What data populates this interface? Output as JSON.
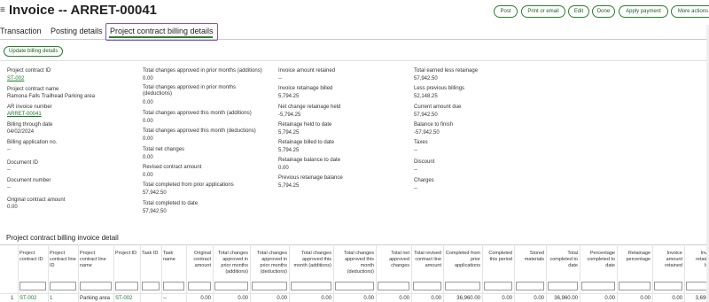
{
  "header": {
    "title": "Invoice -- ARRET-00041",
    "buttons": [
      "Post",
      "Print or email",
      "Edit",
      "Done",
      "Apply payment",
      "More actions"
    ]
  },
  "tabs": [
    "Transaction",
    "Posting details",
    "Project contract billing details"
  ],
  "update_button": "Update billing details",
  "col1": [
    {
      "label": "Project contract ID",
      "value": "ST-002",
      "link": true
    },
    {
      "label": "Project contract name",
      "value": "Ramona Falls Trailhead Parking area",
      "link": false
    },
    {
      "label": "AR invoice number",
      "value": "ARRET-00041",
      "link": true
    },
    {
      "label": "Billing through date",
      "value": "04/02/2024",
      "link": false
    },
    {
      "label": "Billing application no.",
      "value": "--",
      "link": false
    },
    {
      "label": "Document ID",
      "value": "--",
      "link": false
    },
    {
      "label": "Document number",
      "value": "--",
      "link": false
    },
    {
      "label": "Original contract amount",
      "value": "0.00",
      "link": false
    }
  ],
  "col2": [
    {
      "label": "Total changes approved in prior months (additions)",
      "value": "0.00"
    },
    {
      "label": "Total changes approved in prior months (deductions)",
      "value": "0.00"
    },
    {
      "label": "Total changes approved this month (additions)",
      "value": "0.00"
    },
    {
      "label": "Total changes approved this month (deductions)",
      "value": "0.00"
    },
    {
      "label": "Total net changes",
      "value": "0.00"
    },
    {
      "label": "Revised contract amount",
      "value": "0.00"
    },
    {
      "label": "Total completed from prior applications",
      "value": "57,942.50"
    },
    {
      "label": "Total completed to date",
      "value": "57,942.50"
    }
  ],
  "col3": [
    {
      "label": "Invoice amount retained",
      "value": "--"
    },
    {
      "label": "Invoice retainage billed",
      "value": "5,794.25"
    },
    {
      "label": "Net change retainage held",
      "value": "-5,794.25"
    },
    {
      "label": "Retainage held to date",
      "value": "5,794.25"
    },
    {
      "label": "Retainage billed to date",
      "value": "5,794.25"
    },
    {
      "label": "Retainage balance to date",
      "value": "0.00"
    },
    {
      "label": "Previous retainage balance",
      "value": "5,794.25"
    }
  ],
  "col4": [
    {
      "label": "Total earned less retainage",
      "value": "57,942.50"
    },
    {
      "label": "Less previous billings",
      "value": "52,148.25"
    },
    {
      "label": "Current amount due",
      "value": "57,942.50"
    },
    {
      "label": "Balance to finish",
      "value": "-57,942.50"
    },
    {
      "label": "Taxes",
      "value": "--"
    },
    {
      "label": "Discount",
      "value": "--"
    },
    {
      "label": "Charges",
      "value": "--"
    }
  ],
  "detail": {
    "title": "Project contract billing invoice detail",
    "columns": [
      "Project contract ID",
      "Project contract line ID",
      "Project contract line name",
      "Project ID",
      "Task ID",
      "Task name",
      "Original contract amount",
      "Total changes approved in prior months (additions)",
      "Total changes approved in prior months (deductions)",
      "Total changes approved this month (additions)",
      "Total changes approved this month (deductions)",
      "Total net approved changes",
      "Total revised contract line amount",
      "Completed from prior applications",
      "Completed this period",
      "Stored materials",
      "Total completed to date",
      "Percentage completed to date",
      "Retainage percentage",
      "Invoice amount retained",
      "Invoice retainage billed"
    ],
    "row": {
      "num": "1",
      "cells": [
        "ST-002",
        "1",
        "Parking area",
        "ST-002",
        "",
        "--",
        "0.00",
        "0.00",
        "0.00",
        "0.00",
        "0.00",
        "0.00",
        "0.00",
        "36,960.00",
        "0.00",
        "0.00",
        "36,960.00",
        "0.00",
        "0.00",
        "0.00",
        "3,696.00"
      ]
    }
  }
}
